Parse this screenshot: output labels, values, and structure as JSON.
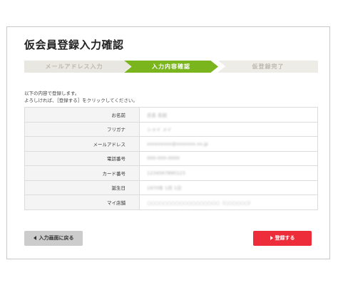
{
  "page": {
    "title": "仮会員登録入力確認"
  },
  "steps": [
    {
      "label": "メールアドレス入力",
      "state": "done"
    },
    {
      "label": "入力内容確認",
      "state": "current"
    },
    {
      "label": "仮登録完了",
      "state": "pending"
    }
  ],
  "intro": {
    "line1": "以下の内容で登録します。",
    "line2": "よろしければ、［登録する］をクリックしてください。"
  },
  "fields": [
    {
      "label": "お名前",
      "value": "氏名 名前"
    },
    {
      "label": "フリガナ",
      "value": "シメイ メイ"
    },
    {
      "label": "メールアドレス",
      "value": "xxxxxxxxx@xxxxxxx.xx.jp"
    },
    {
      "label": "電話番号",
      "value": "000-000-0000"
    },
    {
      "label": "カード番号",
      "value": "1234567890123"
    },
    {
      "label": "誕生日",
      "value": "1970年 1月 1日"
    },
    {
      "label": "マイ店舗",
      "value": "○○○○○○○○○○○○○○○○○○（○○○○○○）"
    }
  ],
  "buttons": {
    "back": "入力画面に戻る",
    "submit": "登録する"
  },
  "colors": {
    "step_active": "#7ab51d",
    "step_inactive": "#e9e7e1",
    "submit_button": "#ee2d3a",
    "back_button": "#cccccc"
  }
}
